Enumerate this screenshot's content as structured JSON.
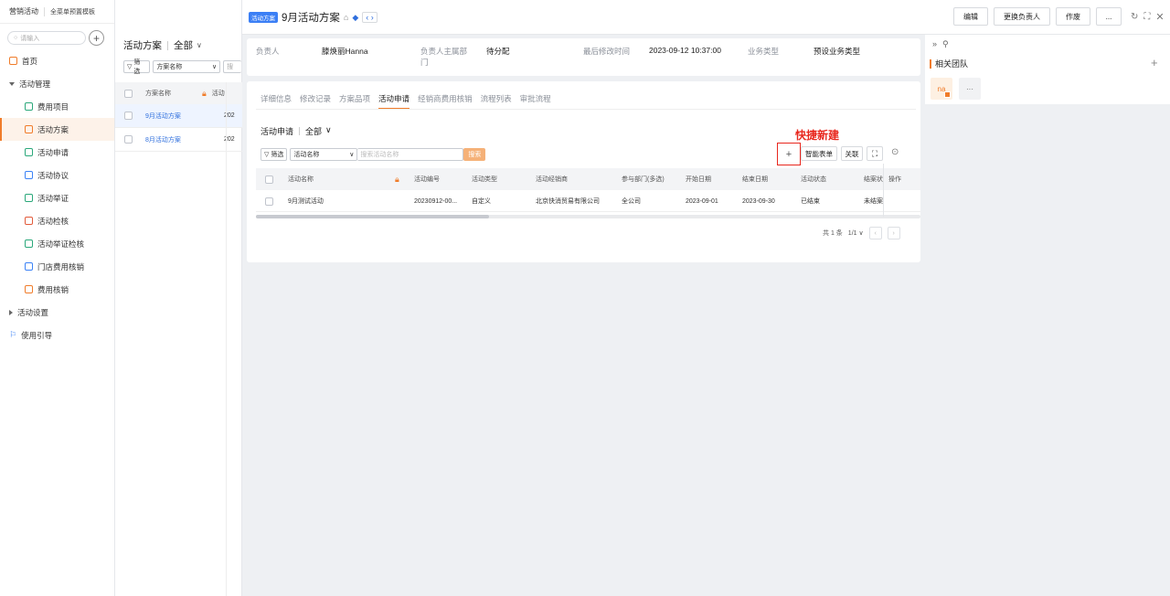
{
  "app": {
    "title": "营销活动",
    "subtitle": "全菜单预置模板"
  },
  "search": {
    "placeholder": "请输入"
  },
  "nav": {
    "home": "首页",
    "group": "活动管理",
    "items": [
      "费用项目",
      "活动方案",
      "活动申请",
      "活动协议",
      "活动举证",
      "活动检核",
      "活动举证检核",
      "门店费用核销",
      "费用核销"
    ],
    "settings": "活动设置",
    "guide": "使用引导"
  },
  "list": {
    "title": "活动方案",
    "scope": "全部",
    "filter": "筛选",
    "field": "方案名称",
    "search_stub": "搜",
    "col_name": "方案名称",
    "col_extra": "活动",
    "rows": [
      {
        "name": "9月活动方案",
        "extra": "202"
      },
      {
        "name": "8月活动方案",
        "extra": "202"
      }
    ]
  },
  "header": {
    "tag": "活动方案",
    "title": "9月活动方案",
    "actions": [
      "编辑",
      "更换负责人",
      "作废",
      "..."
    ]
  },
  "info": {
    "owner_label": "负责人",
    "owner_value": "滕焕丽Hanna",
    "dept_label": "负责人主属部门",
    "dept_value": "待分配",
    "modified_label": "最后修改时间",
    "modified_value": "2023-09-12 10:37:00",
    "biz_label": "业务类型",
    "biz_value": "预设业务类型"
  },
  "tabs": [
    "详细信息",
    "修改记录",
    "方案品项",
    "活动申请",
    "经销商费用核销",
    "流程列表",
    "审批流程"
  ],
  "sub": {
    "title": "活动申请",
    "scope": "全部",
    "filter": "筛选",
    "field": "活动名称",
    "placeholder": "搜索活动名称",
    "search_btn": "搜索",
    "annotation": "快捷新建",
    "add": "+",
    "smart_form": "智能表单",
    "relate": "关联"
  },
  "table": {
    "headers": [
      "活动名称",
      "活动编号",
      "活动类型",
      "活动经销商",
      "参与部门(多选)",
      "开始日期",
      "结束日期",
      "活动状态",
      "结案状",
      "操作"
    ],
    "rows": [
      [
        "9月测试活动",
        "20230912-00...",
        "自定义",
        "北京快消贸易有限公司",
        "全公司",
        "2023-09-01",
        "2023-09-30",
        "已结束",
        "未结案",
        ""
      ]
    ],
    "footer": {
      "total": "共 1 条",
      "page": "1/1"
    }
  },
  "team": {
    "title": "相关团队",
    "avatar": "na",
    "more": "···"
  },
  "colors": {
    "accent": "#f07c2a",
    "link": "#2f6fdd",
    "tag": "#3b7ff5",
    "annotation": "#e8271e"
  }
}
